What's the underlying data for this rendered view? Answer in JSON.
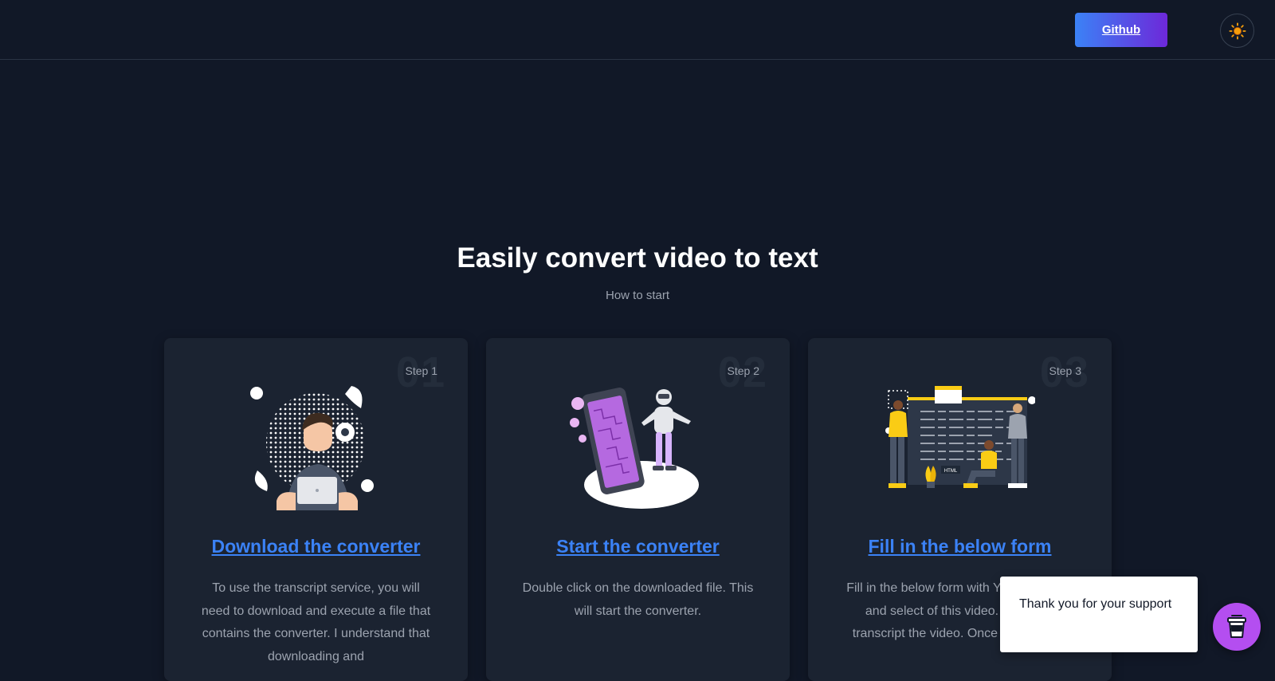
{
  "header": {
    "github_label": "Github",
    "theme_icon": "sun-icon"
  },
  "hero": {
    "title": "Easily convert video to text",
    "subtitle": "How to start"
  },
  "steps": [
    {
      "number": "01",
      "label": "Step 1",
      "title": "Download the converter",
      "description": "To use the transcript service, you will need to download and execute a file that contains the converter. I understand that downloading and",
      "icon": "developer-laptop-illustration"
    },
    {
      "number": "02",
      "label": "Step 2",
      "title": "Start the converter",
      "description": "Double click on the downloaded file. This will start the converter.",
      "icon": "robot-phone-illustration"
    },
    {
      "number": "03",
      "label": "Step 3",
      "title": "Fill in the below form",
      "description": "Fill in the below form with Youtube video and select of this video. The conv transcript the video. Once the process",
      "icon": "team-code-illustration"
    }
  ],
  "toast": {
    "message": "Thank you for your support"
  },
  "support_button": {
    "icon": "coffee-cup-icon"
  },
  "colors": {
    "background": "#111827",
    "card": "#1b2331",
    "link": "#3b82f6",
    "github_gradient_start": "#3b82f6",
    "github_gradient_end": "#6d28d9",
    "coffee": "#b44ef0"
  }
}
